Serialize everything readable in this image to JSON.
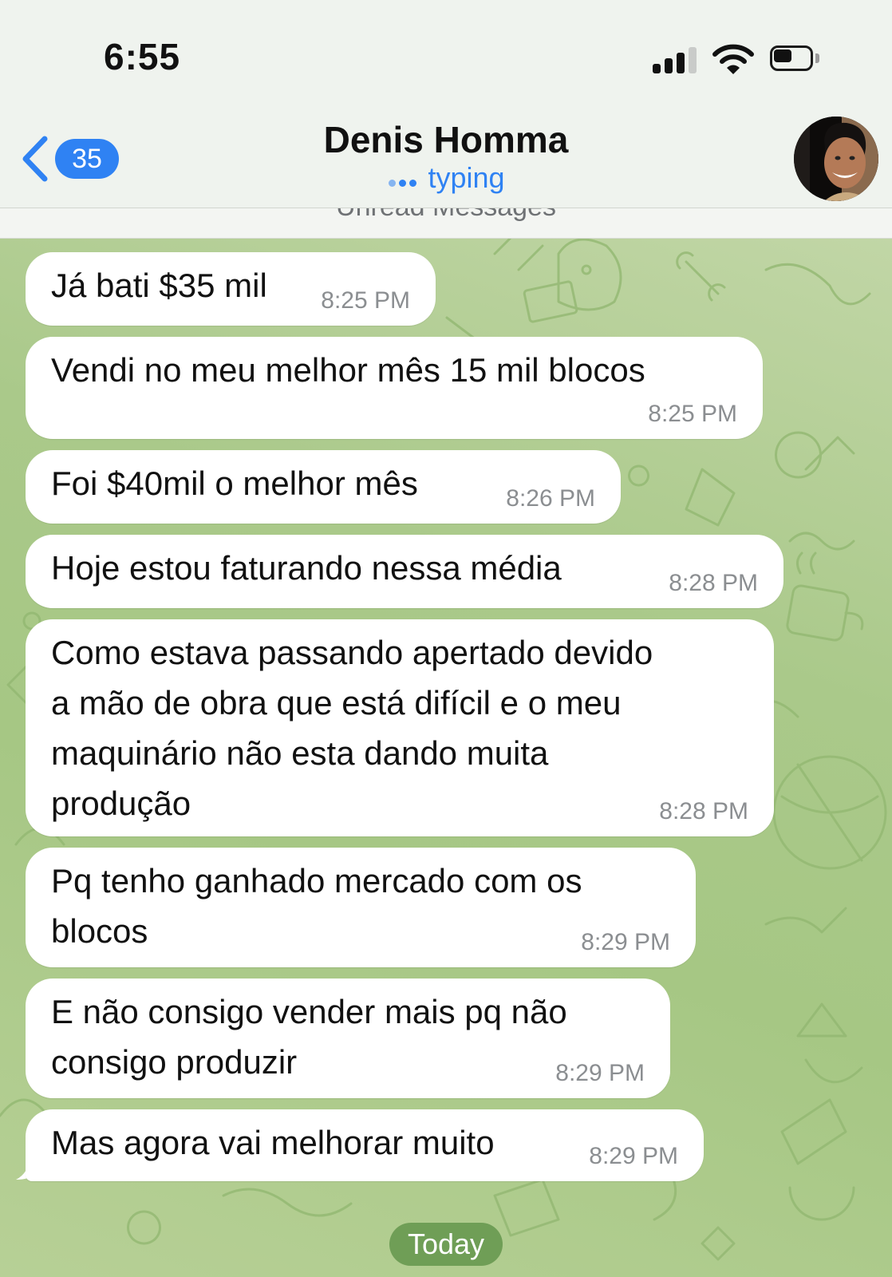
{
  "status_bar": {
    "time": "6:55",
    "icons": [
      "cellular-signal-icon",
      "wifi-icon",
      "battery-icon"
    ]
  },
  "header": {
    "back_badge": "35",
    "contact_name": "Denis Homma",
    "status": "typing",
    "accent_color": "#2f82f3"
  },
  "divider": {
    "label": "Unread Messages"
  },
  "messages": [
    {
      "text": "Já bati $35 mil",
      "time": "8:25 PM"
    },
    {
      "text": "Vendi no meu melhor mês 15 mil blocos",
      "time": "8:25 PM"
    },
    {
      "text": "Foi $40mil o melhor mês",
      "time": "8:26 PM"
    },
    {
      "text": "Hoje estou faturando nessa média",
      "time": "8:28 PM"
    },
    {
      "lines": [
        "Como estava passando apertado devido",
        "a mão de obra que está difícil e o meu",
        "maquinário não esta dando muita",
        "produção"
      ],
      "time": "8:28 PM"
    },
    {
      "lines": [
        "Pq tenho ganhado mercado com os",
        "blocos"
      ],
      "time": "8:29 PM"
    },
    {
      "lines": [
        "E não consigo vender mais pq não",
        "consigo produzir"
      ],
      "time": "8:29 PM"
    },
    {
      "text": "Mas agora vai melhorar muito",
      "time": "8:29 PM"
    }
  ],
  "date_separator": "Today",
  "colors": {
    "bubble": "#ffffff",
    "timestamp": "#8b8e91",
    "date_pill": "#6f9e56",
    "chat_background": "#aac98a"
  }
}
